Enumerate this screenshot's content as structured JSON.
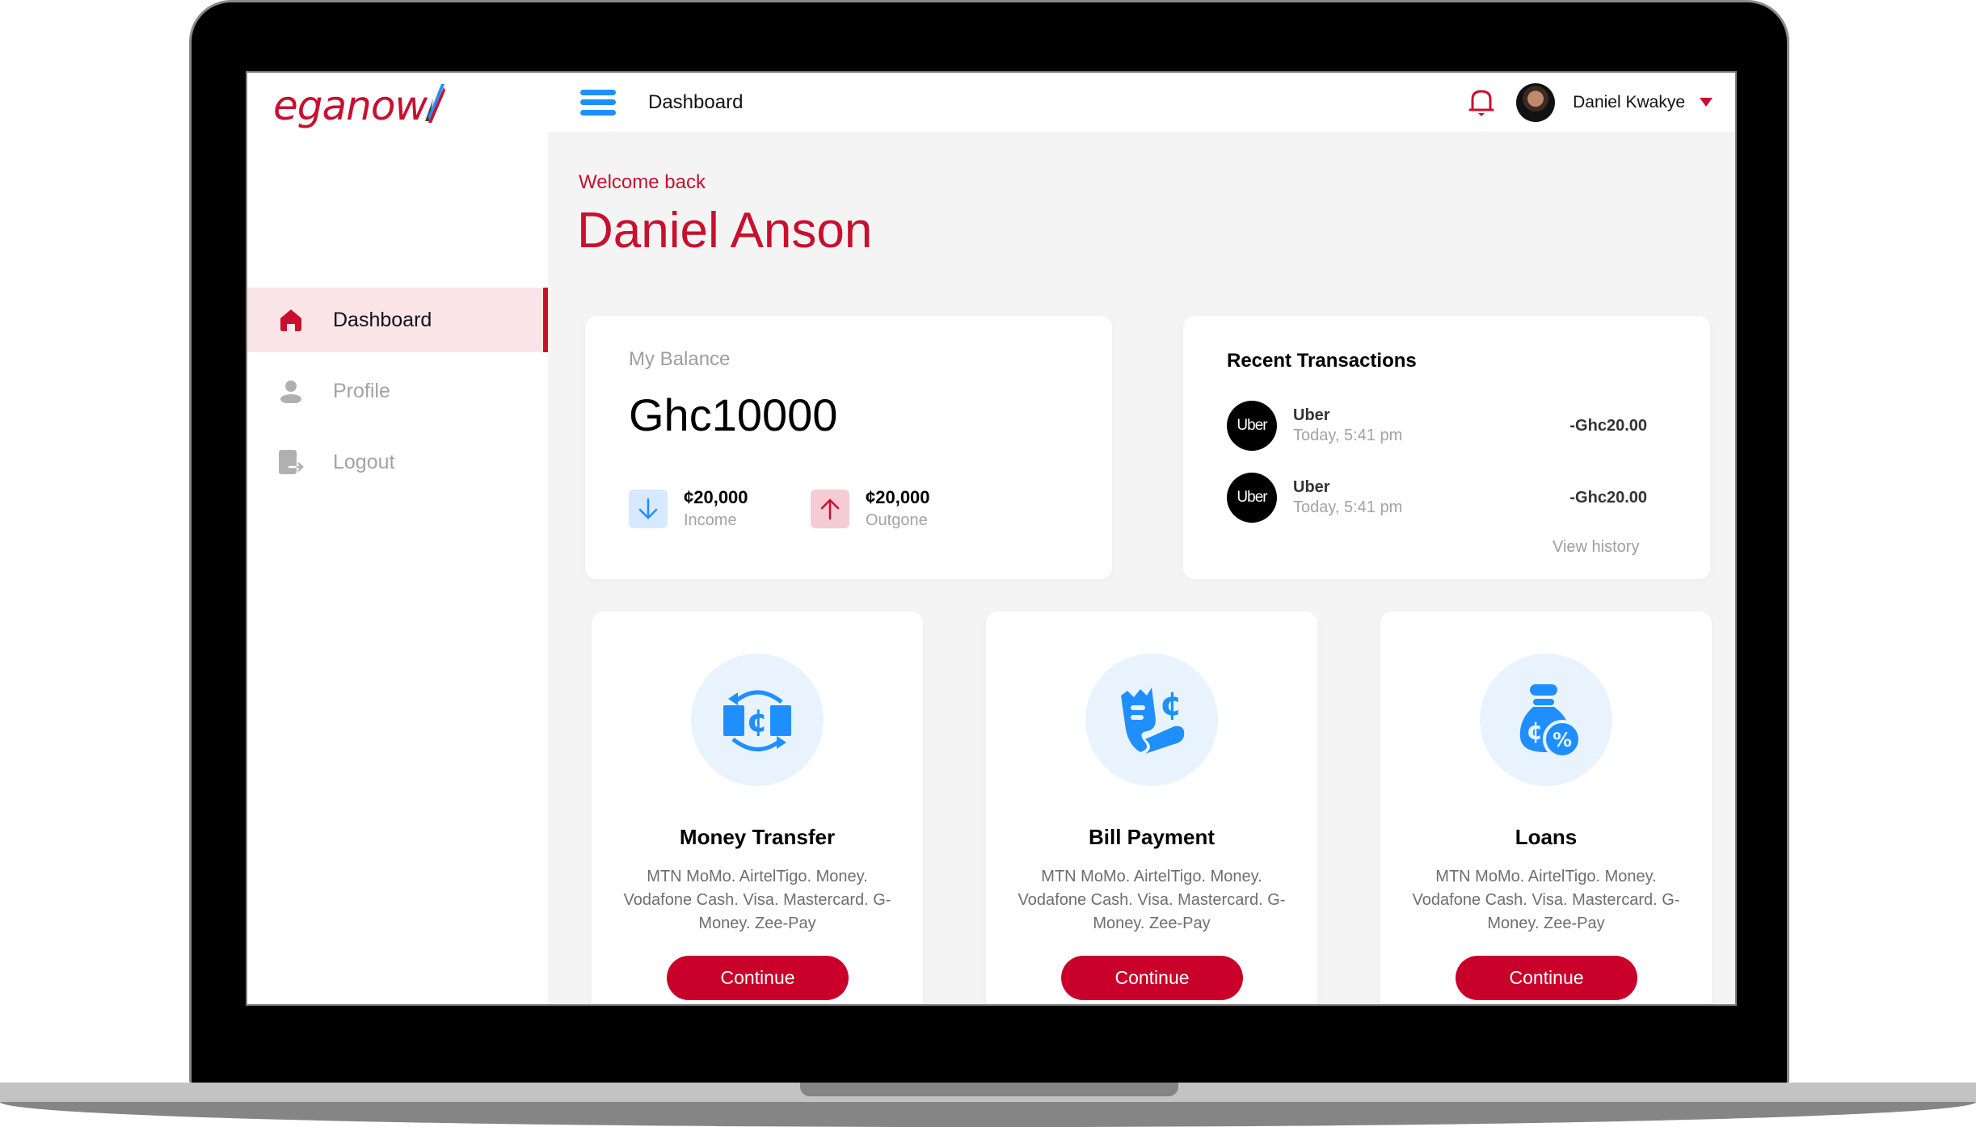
{
  "app": {
    "logo_text": "eganow",
    "brand_color": "#c8102e",
    "accent_color": "#1f8fff"
  },
  "sidebar": {
    "items": [
      {
        "label": "Dashboard",
        "icon": "home-icon",
        "active": true
      },
      {
        "label": "Profile",
        "icon": "user-icon",
        "active": false
      },
      {
        "label": "Logout",
        "icon": "logout-icon",
        "active": false
      }
    ]
  },
  "header": {
    "title": "Dashboard",
    "user_name": "Daniel Kwakye",
    "notification_icon": "bell-icon"
  },
  "welcome": {
    "greeting": "Welcome back",
    "name": "Daniel Anson"
  },
  "balance": {
    "label": "My Balance",
    "value": "Ghc10000",
    "income": {
      "value": "¢20,000",
      "label": "Income"
    },
    "outgone": {
      "value": "¢20,000",
      "label": "Outgone"
    }
  },
  "transactions": {
    "title": "Recent Transactions",
    "items": [
      {
        "logo": "Uber",
        "name": "Uber",
        "time": "Today, 5:41 pm",
        "amount": "-Ghc20.00"
      },
      {
        "logo": "Uber",
        "name": "Uber",
        "time": "Today, 5:41 pm",
        "amount": "-Ghc20.00"
      }
    ],
    "view_history": "View history"
  },
  "services": [
    {
      "title": "Money Transfer",
      "icon": "money-transfer-icon",
      "description": "MTN MoMo. AirtelTigo. Money. Vodafone Cash. Visa. Mastercard. G-Money. Zee-Pay",
      "button": "Continue"
    },
    {
      "title": "Bill Payment",
      "icon": "bill-payment-icon",
      "description": "MTN MoMo. AirtelTigo. Money. Vodafone Cash. Visa. Mastercard. G-Money. Zee-Pay",
      "button": "Continue"
    },
    {
      "title": "Loans",
      "icon": "loans-icon",
      "description": "MTN MoMo. AirtelTigo. Money. Vodafone Cash. Visa. Mastercard. G-Money. Zee-Pay",
      "button": "Continue"
    }
  ]
}
